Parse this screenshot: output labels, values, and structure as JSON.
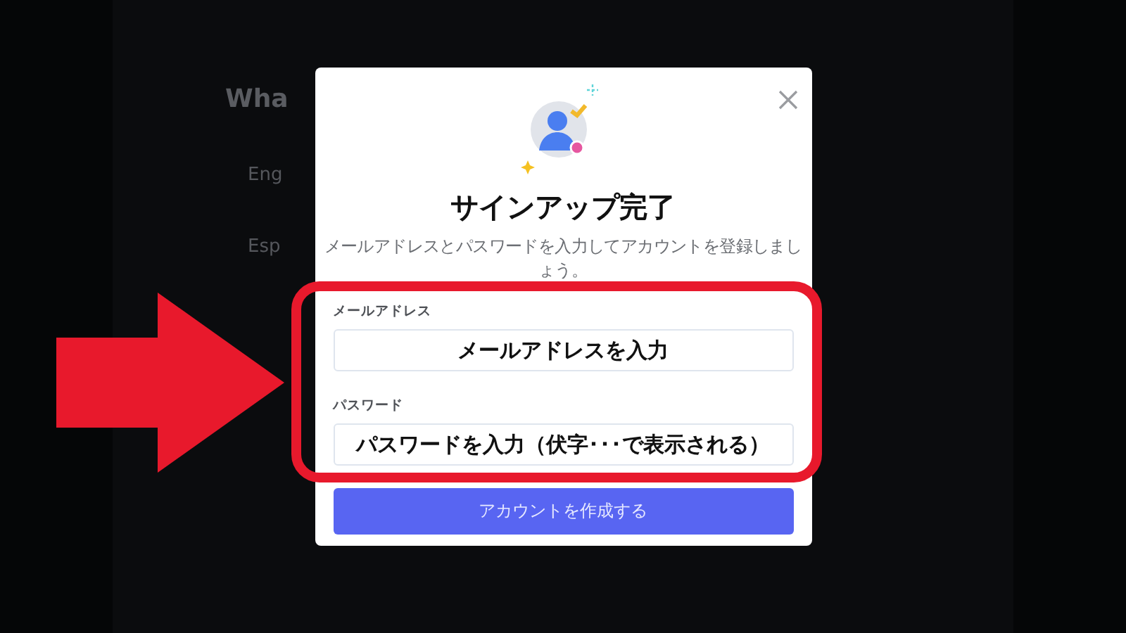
{
  "background": {
    "heading": "Wha",
    "items": [
      "Eng",
      "Esp"
    ]
  },
  "dialog": {
    "title": "サインアップ完了",
    "description": "メールアドレスとパスワードを入力してアカウントを登録しましょう。",
    "fields": [
      {
        "label": "メールアドレス",
        "placeholder": "メールアドレスを入力"
      },
      {
        "label": "パスワード",
        "placeholder": "パスワードを入力（伏字･･･で表示される）"
      }
    ],
    "submit": "アカウントを作成する"
  }
}
